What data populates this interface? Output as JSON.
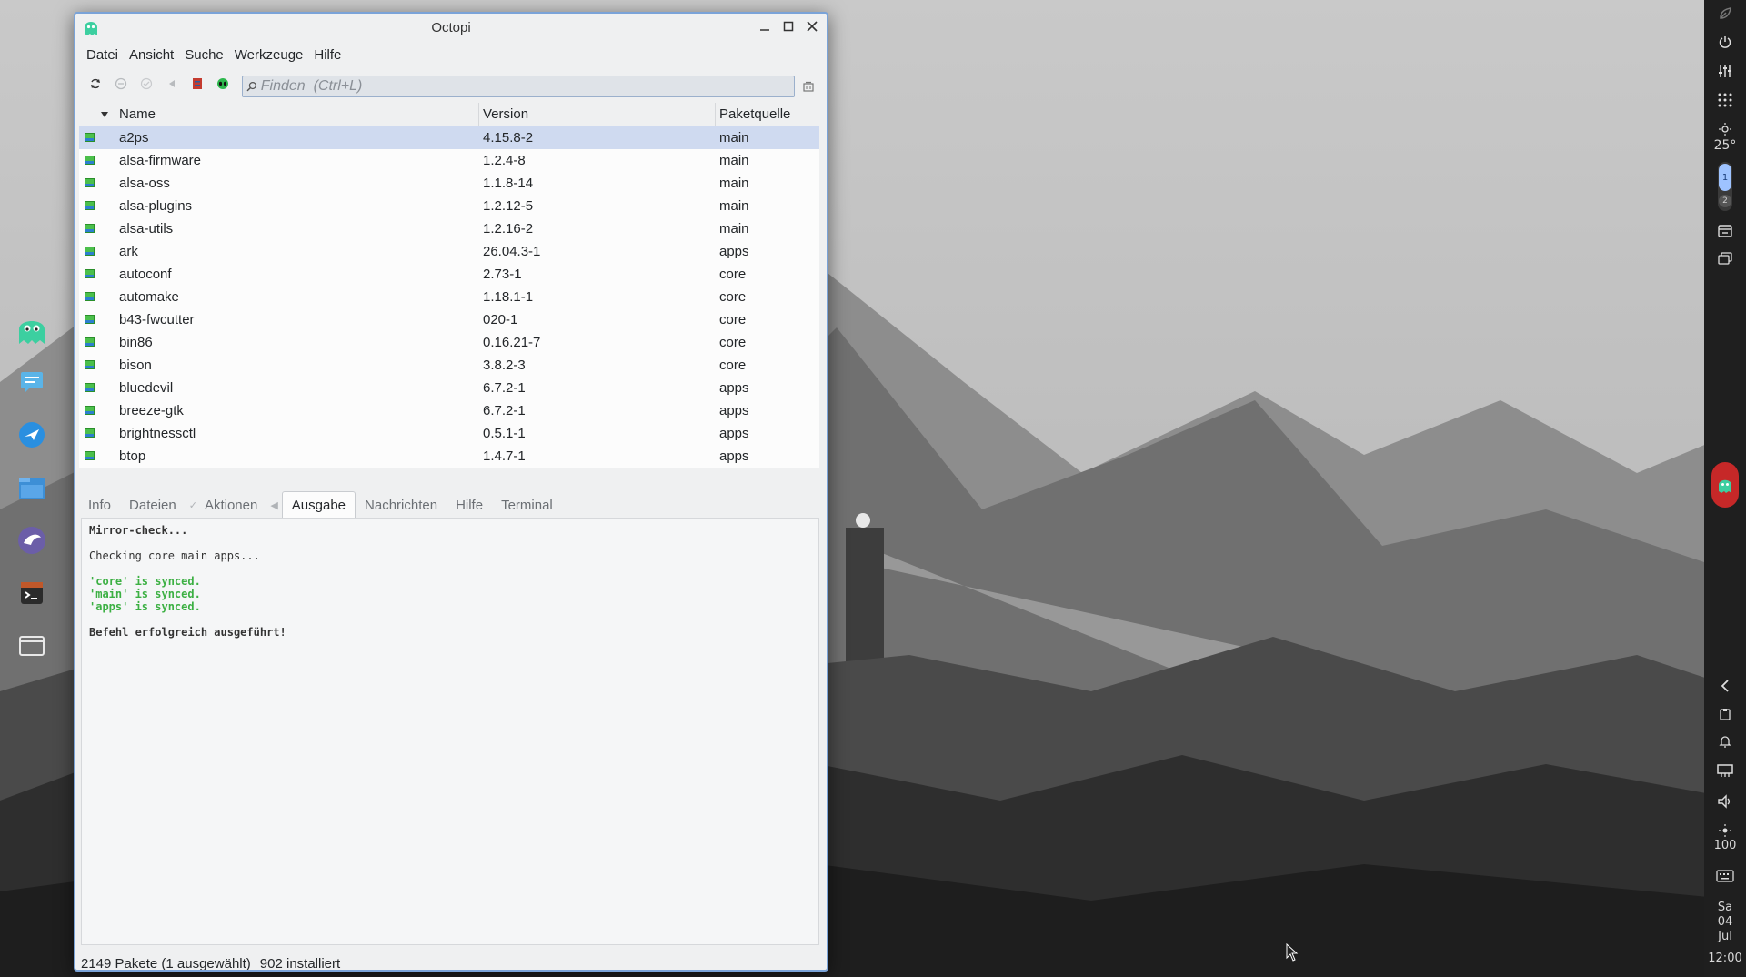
{
  "desktop": {
    "left_dock": [
      {
        "name": "octopi-ghost-icon"
      },
      {
        "name": "chat-icon"
      },
      {
        "name": "browser-icon"
      },
      {
        "name": "file-manager-icon"
      },
      {
        "name": "eagle-icon"
      },
      {
        "name": "terminal-icon"
      },
      {
        "name": "window-icon"
      }
    ],
    "right_panel": {
      "temperature": "25°",
      "workspace_1": "1",
      "workspace_2": "2",
      "brightness": "100",
      "date_day": "Sa",
      "date_num": "04",
      "date_month": "Jul",
      "time": "12:00"
    }
  },
  "window": {
    "title": "Octopi",
    "menu": [
      "Datei",
      "Ansicht",
      "Suche",
      "Werkzeuge",
      "Hilfe"
    ],
    "search": {
      "placeholder": "Finden  (Ctrl+L)",
      "value": ""
    },
    "table": {
      "columns": [
        "Name",
        "Version",
        "Paketquelle"
      ],
      "rows": [
        {
          "name": "a2ps",
          "version": "4.15.8-2",
          "repo": "main",
          "selected": true
        },
        {
          "name": "alsa-firmware",
          "version": "1.2.4-8",
          "repo": "main"
        },
        {
          "name": "alsa-oss",
          "version": "1.1.8-14",
          "repo": "main"
        },
        {
          "name": "alsa-plugins",
          "version": "1.2.12-5",
          "repo": "main"
        },
        {
          "name": "alsa-utils",
          "version": "1.2.16-2",
          "repo": "main"
        },
        {
          "name": "ark",
          "version": "26.04.3-1",
          "repo": "apps"
        },
        {
          "name": "autoconf",
          "version": "2.73-1",
          "repo": "core"
        },
        {
          "name": "automake",
          "version": "1.18.1-1",
          "repo": "core"
        },
        {
          "name": "b43-fwcutter",
          "version": "020-1",
          "repo": "core"
        },
        {
          "name": "bin86",
          "version": "0.16.21-7",
          "repo": "core"
        },
        {
          "name": "bison",
          "version": "3.8.2-3",
          "repo": "core"
        },
        {
          "name": "bluedevil",
          "version": "6.7.2-1",
          "repo": "apps"
        },
        {
          "name": "breeze-gtk",
          "version": "6.7.2-1",
          "repo": "apps"
        },
        {
          "name": "brightnessctl",
          "version": "0.5.1-1",
          "repo": "apps"
        },
        {
          "name": "btop",
          "version": "1.4.7-1",
          "repo": "apps"
        }
      ]
    },
    "tabs": {
      "info": "Info",
      "files": "Dateien",
      "actions": "Aktionen",
      "output": "Ausgabe",
      "news": "Nachrichten",
      "help": "Hilfe",
      "terminal": "Terminal"
    },
    "output": {
      "line1": "Mirror-check...",
      "line2": "Checking core main apps...",
      "line3": "'core' is synced.",
      "line4": "'main' is synced.",
      "line5": "'apps' is synced.",
      "line6": "Befehl erfolgreich ausgeführt!"
    },
    "status": {
      "packages": "2149 Pakete (1 ausgewählt)",
      "installed": "902 installiert"
    }
  }
}
